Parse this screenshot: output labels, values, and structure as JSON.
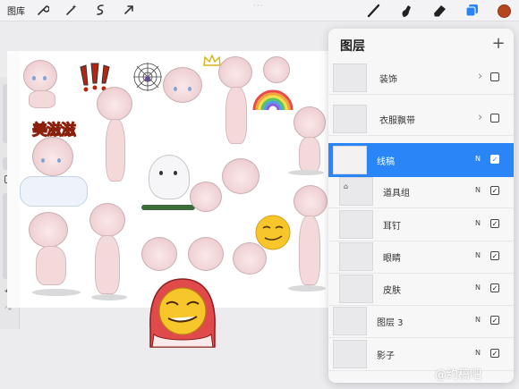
{
  "toolbar": {
    "gallery_label": "图库",
    "left_icons": [
      "wrench-icon",
      "magic-wand-icon",
      "selection-icon",
      "transform-arrow-icon"
    ],
    "right_icons": [
      "brush-icon",
      "smudge-icon",
      "eraser-icon",
      "layers-icon"
    ],
    "dots": "···",
    "active_color": "#b5471e"
  },
  "sidebar": {
    "undo_icon": "↶",
    "redo_icon": "↷"
  },
  "canvas": {
    "sticker_text": "美滋滋"
  },
  "layers_panel": {
    "title": "图层",
    "add_label": "+",
    "layers": [
      {
        "name": "装饰",
        "type": "group",
        "mode": "",
        "visible": false,
        "selected": false
      },
      {
        "name": "衣服飘带",
        "type": "group",
        "mode": "",
        "visible": false,
        "selected": false
      },
      {
        "name": "线稿",
        "type": "layer",
        "mode": "N",
        "visible": true,
        "selected": true
      },
      {
        "name": "道具组",
        "type": "layer",
        "mode": "N",
        "visible": true,
        "selected": false
      },
      {
        "name": "耳钉",
        "type": "layer",
        "mode": "N",
        "visible": true,
        "selected": false
      },
      {
        "name": "眼睛",
        "type": "layer",
        "mode": "N",
        "visible": true,
        "selected": false
      },
      {
        "name": "皮肤",
        "type": "layer",
        "mode": "N",
        "visible": true,
        "selected": false
      },
      {
        "name": "图层 3",
        "type": "layer",
        "mode": "N",
        "visible": true,
        "selected": false
      },
      {
        "name": "影子",
        "type": "layer",
        "mode": "N",
        "visible": true,
        "selected": false
      }
    ]
  },
  "watermark": "@约稿吧",
  "colors": {
    "accent": "#2a86f6",
    "panel_bg": "#f7f7f8"
  }
}
